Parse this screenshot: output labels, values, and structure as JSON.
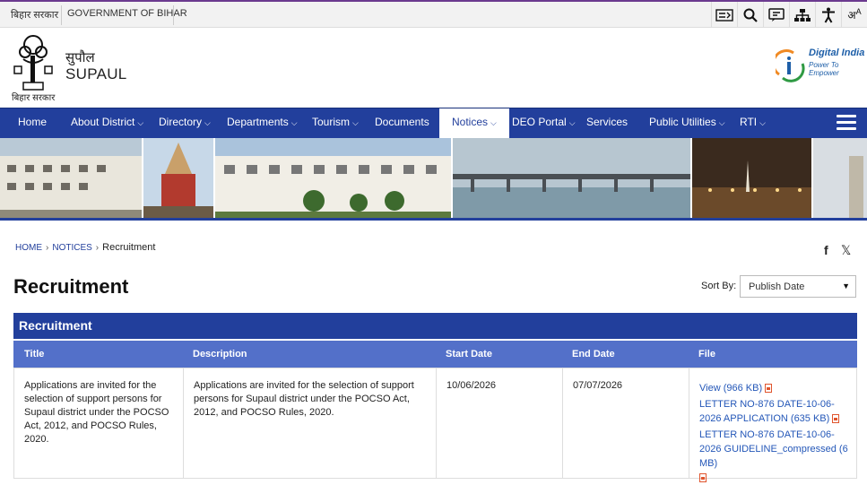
{
  "topbar": {
    "lang_link": "बिहार सरकार",
    "gov_link": "GOVERNMENT OF BIHAR",
    "tools": [
      "skip-to-content-icon",
      "search-icon",
      "sitemap-chat-icon",
      "sitemap-icon",
      "accessibility-icon",
      "language-icon"
    ]
  },
  "header": {
    "emblem_caption": "बिहार सरकार",
    "site_hindi": "सुपौल",
    "site_name": "SUPAUL",
    "digital_india": "Digital India",
    "digital_india_tag": "Power To Empower"
  },
  "nav": {
    "items": [
      {
        "label": "Home",
        "dropdown": false
      },
      {
        "label": "About District",
        "dropdown": true
      },
      {
        "label": "Directory",
        "dropdown": true
      },
      {
        "label": "Departments",
        "dropdown": true
      },
      {
        "label": "Tourism",
        "dropdown": true
      },
      {
        "label": "Documents",
        "dropdown": false
      },
      {
        "label": "Notices",
        "dropdown": true,
        "active": true
      },
      {
        "label": "DEO Portal",
        "dropdown": true
      },
      {
        "label": "Services",
        "dropdown": false
      },
      {
        "label": "Public Utilities",
        "dropdown": true
      },
      {
        "label": "RTI",
        "dropdown": true
      }
    ]
  },
  "breadcrumb": {
    "home": "HOME",
    "notices": "NOTICES",
    "current": "Recruitment"
  },
  "social": {
    "facebook": "f",
    "x": "𝕏"
  },
  "page": {
    "title": "Recruitment",
    "sort_label": "Sort By:",
    "sort_value": "Publish Date"
  },
  "table": {
    "caption": "Recruitment",
    "headers": {
      "title": "Title",
      "description": "Description",
      "start": "Start Date",
      "end": "End Date",
      "file": "File"
    },
    "rows": [
      {
        "title": "Applications are invited for the selection of support persons for Supaul district under the POCSO Act, 2012, and POCSO Rules, 2020.",
        "description": "Applications are invited for the selection of support persons for Supaul district under the POCSO Act, 2012, and POCSO Rules, 2020.",
        "start": "10/06/2026",
        "end": "07/07/2026",
        "files": [
          "View (966 KB)",
          "LETTER NO-876 DATE-10-06-2026 APPLICATION (635 KB)",
          "LETTER NO-876 DATE-10-06-2026 GUIDELINE_compressed (6 MB)"
        ]
      }
    ]
  },
  "colors": {
    "nav_bg": "#223f9c",
    "col_head_bg": "#5370c9",
    "link": "#2457b8",
    "pdf_icon": "#e0542c"
  }
}
